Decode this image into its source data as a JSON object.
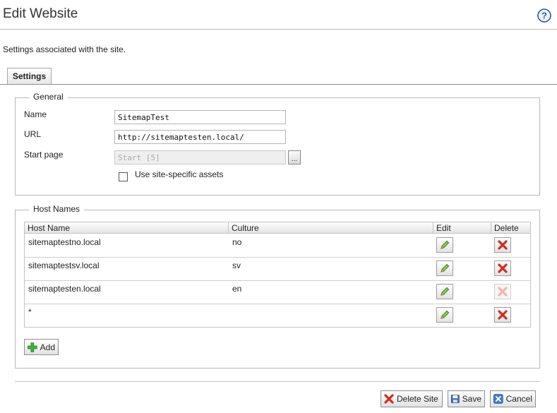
{
  "page": {
    "title": "Edit Website",
    "subtitle": "Settings associated with the site."
  },
  "tabs": [
    {
      "label": "Settings",
      "selected": true
    }
  ],
  "general": {
    "legend": "General",
    "name_label": "Name",
    "name_value": "SitemapTest",
    "url_label": "URL",
    "url_value": "http://sitemaptesten.local/",
    "start_page_label": "Start page",
    "start_page_value": "Start [5]",
    "browse_label": "...",
    "assets_label": "Use site-specific assets",
    "assets_checked": false
  },
  "host_names": {
    "legend": "Host Names",
    "columns": [
      "Host Name",
      "Culture",
      "Edit",
      "Delete"
    ],
    "rows": [
      {
        "host": "sitemaptestno.local",
        "culture": "no",
        "delete_enabled": true
      },
      {
        "host": "sitemaptestsv.local",
        "culture": "sv",
        "delete_enabled": true
      },
      {
        "host": "sitemaptesten.local",
        "culture": "en",
        "delete_enabled": false
      },
      {
        "host": "*",
        "culture": "",
        "delete_enabled": true
      }
    ],
    "add_label": "Add"
  },
  "actions": {
    "delete_site_label": "Delete Site",
    "save_label": "Save",
    "cancel_label": "Cancel"
  },
  "icons": {
    "help": "help-icon",
    "edit": "pencil-icon",
    "delete": "red-x-icon",
    "add": "green-plus-icon",
    "save": "floppy-disk-icon",
    "cancel": "blue-x-icon"
  },
  "colors": {
    "delete_red": "#d42b1e",
    "add_green": "#3bb43b",
    "help_blue": "#2a5d9e",
    "cancel_blue": "#3e7ec8"
  }
}
